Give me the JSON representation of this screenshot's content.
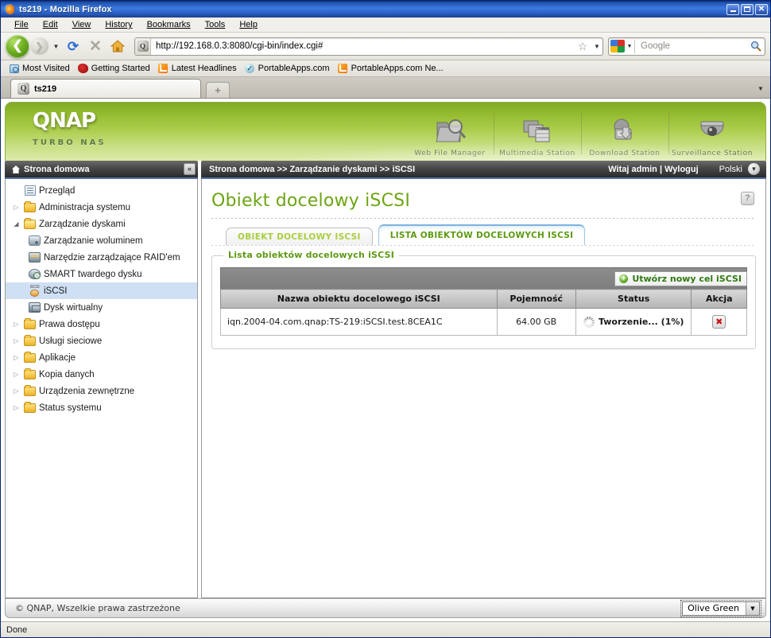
{
  "browser": {
    "window_title": "ts219 - Mozilla Firefox",
    "window_buttons": {
      "minimize": "_",
      "maximize": "□",
      "close": "✕"
    },
    "menu": [
      {
        "label": "File"
      },
      {
        "label": "Edit"
      },
      {
        "label": "View"
      },
      {
        "label": "History"
      },
      {
        "label": "Bookmarks"
      },
      {
        "label": "Tools"
      },
      {
        "label": "Help"
      }
    ],
    "toolbar": {
      "back": "❮",
      "forward": "❯",
      "history_dropdown": "▼",
      "reload": "⟳",
      "stop": "✕",
      "home": "home-icon",
      "url": "http://192.168.0.3:8080/cgi-bin/index.cgi#",
      "bookmark_star": "☆",
      "url_dropdown": "▼",
      "search_engine": "Google",
      "search_placeholder": "Google",
      "search_dropdown": "▼",
      "search_go": "🔍"
    },
    "bookmarks": [
      {
        "label": "Most Visited",
        "icon": "most-visited-icon"
      },
      {
        "label": "Getting Started",
        "icon": "getting-started-icon"
      },
      {
        "label": "Latest Headlines",
        "icon": "rss-icon"
      },
      {
        "label": "PortableApps.com",
        "icon": "portableapps-icon"
      },
      {
        "label": "PortableApps.com Ne...",
        "icon": "rss-icon"
      }
    ],
    "tabs": [
      {
        "label": "ts219",
        "active": true
      }
    ],
    "new_tab_label": "+",
    "tab_list_all": "▼",
    "status_text": "Done"
  },
  "qnap": {
    "logo": "QNAP",
    "tagline": "TURBO NAS",
    "stations": [
      {
        "label": "Web File Manager",
        "icon": "folder-magnifier-icon"
      },
      {
        "label": "Multimedia Station",
        "icon": "media-clapper-icon"
      },
      {
        "label": "Download Station",
        "icon": "download-arrow-icon"
      },
      {
        "label": "Surveillance Station",
        "icon": "dome-camera-icon"
      }
    ],
    "sidebar_header": {
      "title": "Strona domowa",
      "home_icon": "home-icon",
      "collapse_icon": "«"
    },
    "breadcrumb": "Strona domowa >> Zarządzanie dyskami >> iSCSI",
    "welcome": "Witaj admin | Wyloguj",
    "language": "Polski",
    "language_arrow": "▼",
    "sidebar": {
      "items": [
        {
          "label": "Przegląd",
          "icon": "overview-icon",
          "twisty": "",
          "level": 0,
          "selected": false
        },
        {
          "label": "Administracja systemu",
          "icon": "folder-icon",
          "twisty": "▷",
          "level": 0,
          "selected": false
        },
        {
          "label": "Zarządzanie dyskami",
          "icon": "folder-open-icon",
          "twisty": "◢",
          "level": 0,
          "selected": false
        },
        {
          "label": "Zarządzanie woluminem",
          "icon": "disk-icon",
          "twisty": "",
          "level": 1,
          "selected": false
        },
        {
          "label": "Narzędzie zarządzające RAID'em",
          "icon": "raid-icon",
          "twisty": "",
          "level": 1,
          "selected": false
        },
        {
          "label": "SMART twardego dysku",
          "icon": "smart-icon",
          "twisty": "",
          "level": 1,
          "selected": false
        },
        {
          "label": "iSCSI",
          "icon": "iscsi-icon",
          "twisty": "",
          "level": 1,
          "selected": true
        },
        {
          "label": "Dysk wirtualny",
          "icon": "virtual-disk-icon",
          "twisty": "",
          "level": 1,
          "selected": false
        },
        {
          "label": "Prawa dostępu",
          "icon": "folder-icon",
          "twisty": "▷",
          "level": 0,
          "selected": false
        },
        {
          "label": "Usługi sieciowe",
          "icon": "folder-icon",
          "twisty": "▷",
          "level": 0,
          "selected": false
        },
        {
          "label": "Aplikacje",
          "icon": "folder-icon",
          "twisty": "▷",
          "level": 0,
          "selected": false
        },
        {
          "label": "Kopia danych",
          "icon": "folder-icon",
          "twisty": "▷",
          "level": 0,
          "selected": false
        },
        {
          "label": "Urządzenia zewnętrzne",
          "icon": "folder-icon",
          "twisty": "▷",
          "level": 0,
          "selected": false
        },
        {
          "label": "Status systemu",
          "icon": "folder-icon",
          "twisty": "▷",
          "level": 0,
          "selected": false
        }
      ]
    },
    "main": {
      "page_title": "Obiekt docelowy iSCSI",
      "help_icon": "?",
      "tabs": [
        {
          "label": "OBIEKT DOCELOWY ISCSI",
          "active": false
        },
        {
          "label": "LISTA OBIEKTÓW DOCELOWYCH ISCSI",
          "active": true
        }
      ],
      "fieldset_legend": "Lista obiektów docelowych iSCSI",
      "create_button": "Utwórz nowy cel iSCSI",
      "create_button_icon": "plus-circle-icon",
      "table": {
        "columns": [
          "Nazwa obiektu docelowego iSCSI",
          "Pojemność",
          "Status",
          "Akcja"
        ],
        "rows": [
          {
            "name": "iqn.2004-04.com.qnap:TS-219:iSCSI.test.8CEA1C",
            "capacity": "64.00 GB",
            "status": "Tworzenie... (1%)",
            "status_icon": "spinner-icon",
            "action_icon": "delete-icon",
            "action_label": "✖"
          }
        ]
      }
    },
    "footer": {
      "copyright": "© QNAP, Wszelkie prawa zastrzeżone",
      "theme": "Olive Green",
      "theme_arrow": "▼"
    },
    "colors": {
      "brand_green": "#8cb82b",
      "title_green": "#6ca513",
      "status_green": "#4e9c12",
      "tab_inactive_green": "#a9cf3f",
      "selection_blue": "#cfe0f5"
    }
  }
}
